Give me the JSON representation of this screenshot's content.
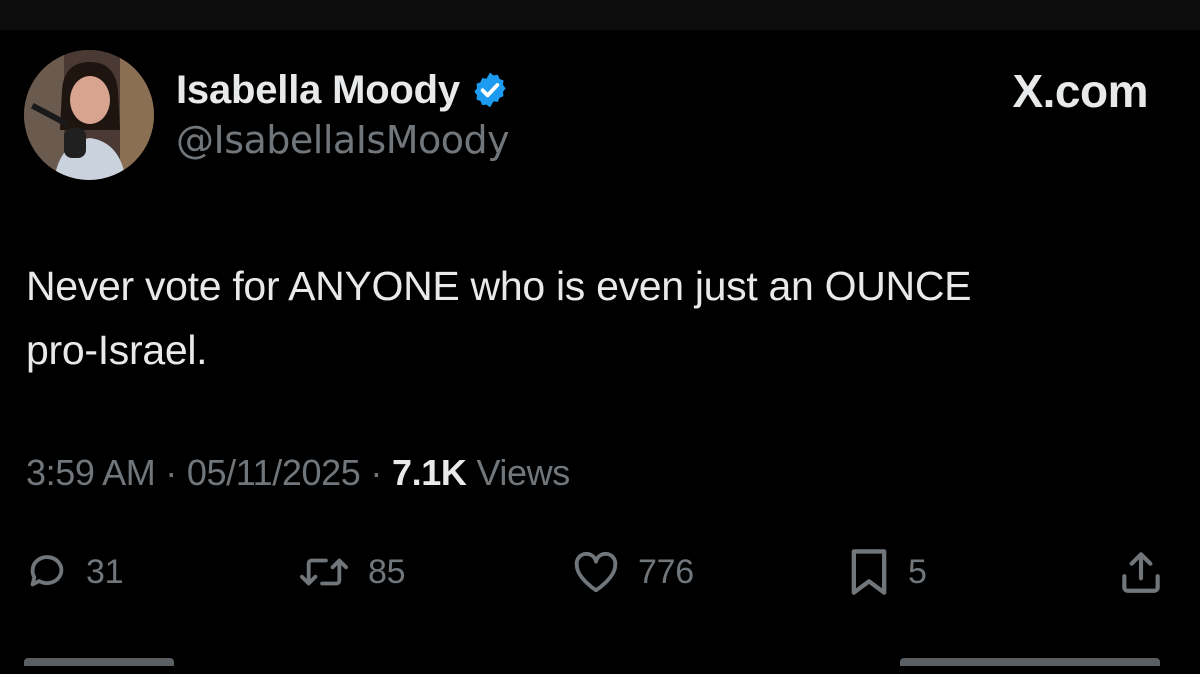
{
  "tweet": {
    "author": {
      "display_name": "Isabella Moody",
      "handle": "@IsabellaIsMoody",
      "verified": true
    },
    "site_label": "X.com",
    "text_lines": [
      "Never vote for ANYONE who is even just an OUNCE",
      "pro-Israel."
    ],
    "meta": {
      "time": "3:59 AM",
      "separator": "·",
      "date": "05/11/2025",
      "views_count": "7.1K",
      "views_label": "Views"
    },
    "actions": {
      "replies": "31",
      "reposts": "85",
      "likes": "776",
      "bookmarks": "5"
    }
  },
  "icons": {
    "verified": "verified-badge-icon",
    "reply": "comment-bubble-icon",
    "repost": "repost-arrows-icon",
    "like": "heart-icon",
    "bookmark": "bookmark-icon",
    "share": "share-upload-icon"
  },
  "colors": {
    "background": "#000000",
    "primary_text": "#e7e9ea",
    "secondary_text": "#71767b",
    "verified_blue": "#1d9bf0"
  }
}
